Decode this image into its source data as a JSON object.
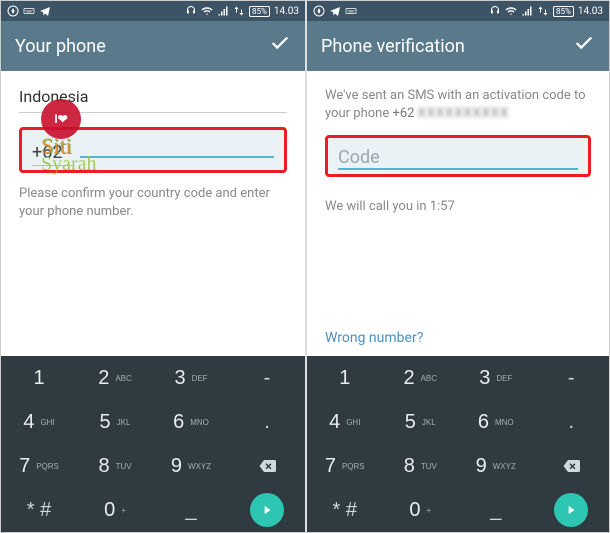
{
  "status": {
    "time": "14.03",
    "battery": "85%"
  },
  "left": {
    "title": "Your phone",
    "country": "Indonesia",
    "country_code": "+62",
    "info": "Please confirm your country code and enter your phone number."
  },
  "right": {
    "title": "Phone verification",
    "info_prefix": "We've sent an SMS with an activation code to your phone ",
    "phone_cc": "+62",
    "phone_hidden": "XXXXXXXXXX",
    "code_placeholder": "Code",
    "call_text": "We will call you in 1:57",
    "wrong": "Wrong number?"
  },
  "keys": [
    {
      "n": "1",
      "l": ""
    },
    {
      "n": "2",
      "l": "ABC"
    },
    {
      "n": "3",
      "l": "DEF"
    },
    {
      "n": "-",
      "l": "",
      "util": true
    },
    {
      "n": "4",
      "l": "GHI"
    },
    {
      "n": "5",
      "l": "JKL"
    },
    {
      "n": "6",
      "l": "MNO"
    },
    {
      "n": ".",
      "l": "",
      "util": true
    },
    {
      "n": "7",
      "l": "PQRS"
    },
    {
      "n": "8",
      "l": "TUV"
    },
    {
      "n": "9",
      "l": "WXYZ"
    },
    {
      "n": "BKSP",
      "l": "",
      "util": true
    },
    {
      "n": "* #",
      "l": "",
      "util": true
    },
    {
      "n": "0",
      "l": "+"
    },
    {
      "n": "_",
      "l": "",
      "util": true
    },
    {
      "n": "GO",
      "l": "",
      "util": true
    }
  ],
  "watermark": {
    "line1": "I❤",
    "line2": "Siti",
    "line3": "Syarah"
  }
}
